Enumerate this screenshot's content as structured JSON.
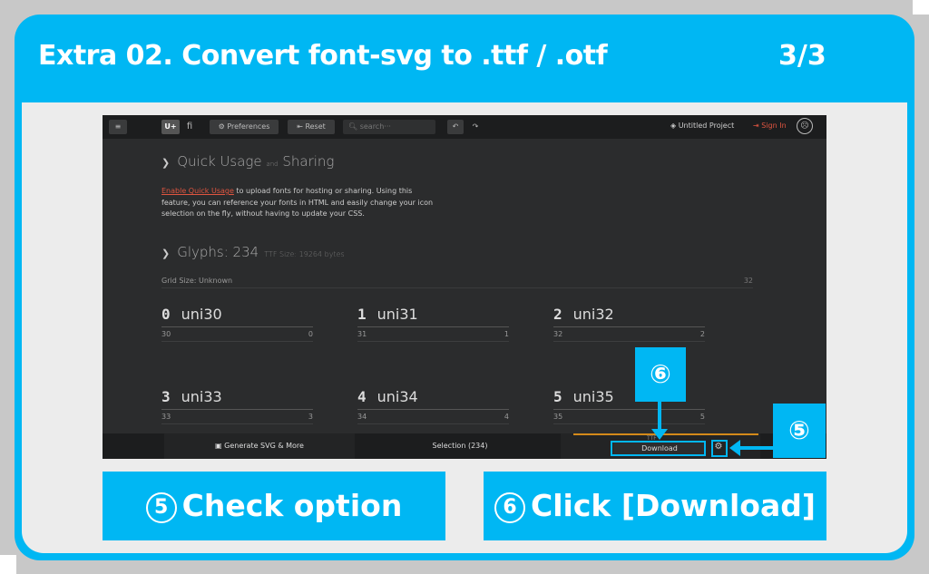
{
  "header": {
    "title": "Extra 02. Convert font-svg to .ttf / .otf",
    "page": "3/3"
  },
  "app": {
    "topbar": {
      "menu_icon": "hamburger-icon",
      "uplus": "U+",
      "fi": "fi",
      "preferences": "Preferences",
      "reset": "Reset",
      "search_placeholder": "search···",
      "project": "Untitled Project",
      "signin": "Sign In"
    },
    "quick_usage": {
      "title_a": "Quick Usage",
      "title_and": "and",
      "title_b": "Sharing",
      "link": "Enable Quick Usage",
      "text": " to upload fonts for hosting or sharing. Using this feature, you can reference your fonts in HTML and easily change your icon selection on the fly, without having to update your CSS."
    },
    "glyphs": {
      "title": "Glyphs: 234",
      "ttf_size": "TTF Size: 19264 bytes",
      "grid_label": "Grid Size: Unknown",
      "grid_value": "32",
      "items": [
        {
          "char": "0",
          "name": "uni30",
          "code": "30",
          "value": "0"
        },
        {
          "char": "1",
          "name": "uni31",
          "code": "31",
          "value": "1"
        },
        {
          "char": "2",
          "name": "uni32",
          "code": "32",
          "value": "2"
        },
        {
          "char": "3",
          "name": "uni33",
          "code": "33",
          "value": "3"
        },
        {
          "char": "4",
          "name": "uni34",
          "code": "34",
          "value": "4"
        },
        {
          "char": "5",
          "name": "uni35",
          "code": "35",
          "value": "5"
        }
      ]
    },
    "bottombar": {
      "generate": "Generate SVG & More",
      "selection": "Selection (234)",
      "ttf": "TTF",
      "download": "Download"
    }
  },
  "annotations": {
    "badge5": "⑤",
    "badge6": "⑥",
    "caption5": "Check option",
    "caption6": "Click [Download]"
  },
  "colors": {
    "accent": "#00b7f3",
    "app_bg": "#2b2c2d",
    "signin": "#e05540"
  }
}
